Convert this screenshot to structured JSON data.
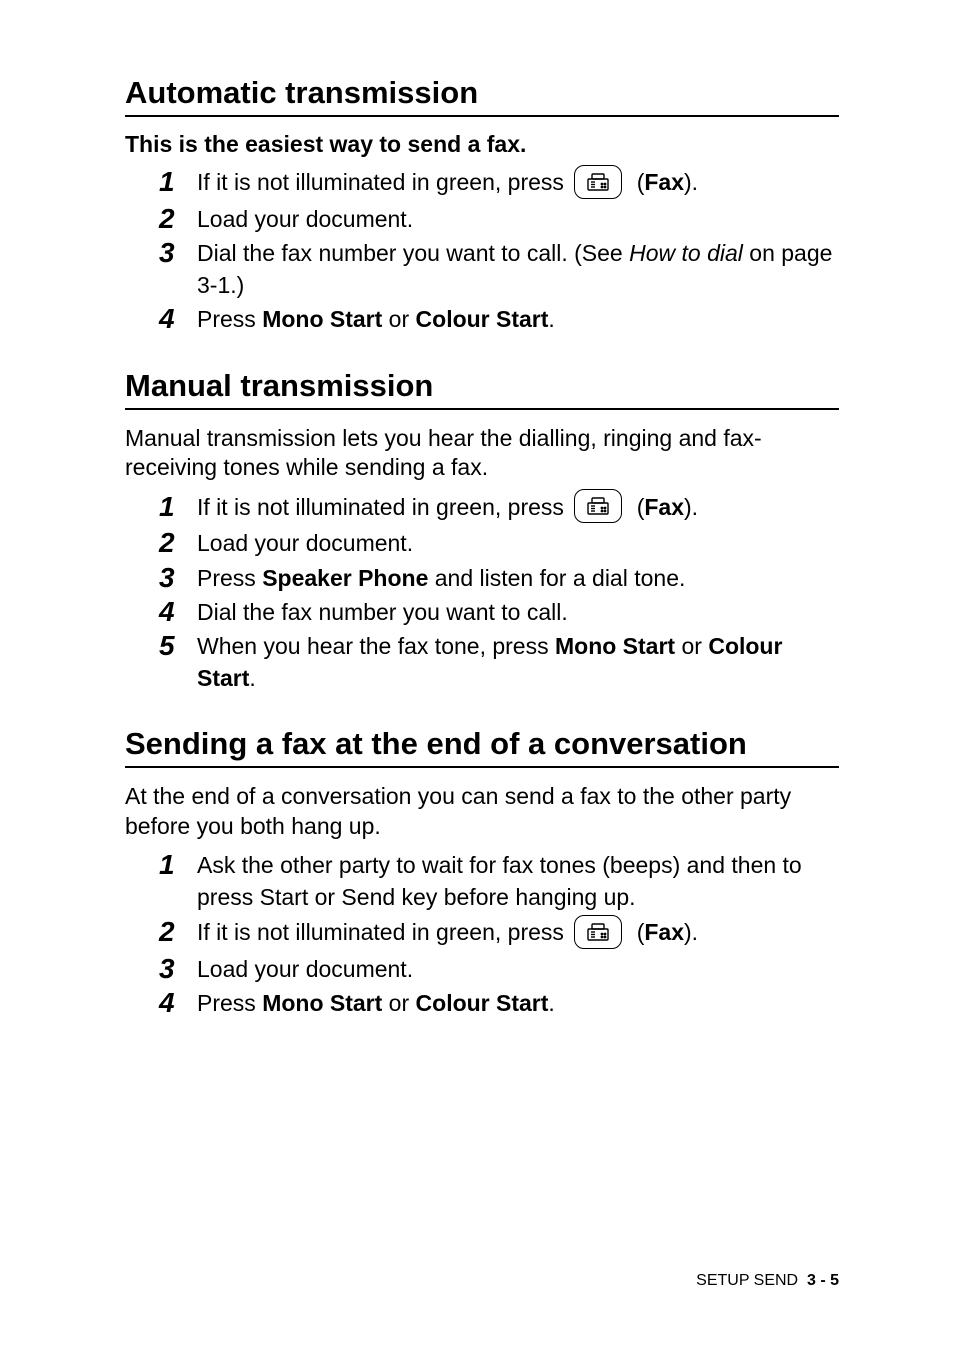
{
  "sections": {
    "auto": {
      "heading": "Automatic transmission",
      "sub": "This is the easiest way to send a fax.",
      "steps": {
        "s1a": "If it is not illuminated in green, press ",
        "s1b": " (",
        "s1c": "Fax",
        "s1d": ").",
        "s2": "Load your document.",
        "s3a": "Dial the fax number you want to call. (See ",
        "s3b": "How to dial",
        "s3c": " on page 3-1.)",
        "s4a": "Press ",
        "s4b": "Mono Start",
        "s4c": " or ",
        "s4d": "Colour Start",
        "s4e": "."
      }
    },
    "manual": {
      "heading": "Manual transmission",
      "intro": "Manual transmission lets you hear the dialling, ringing and fax-receiving tones while sending a fax.",
      "steps": {
        "s1a": "If it is not illuminated in green, press ",
        "s1b": " (",
        "s1c": "Fax",
        "s1d": ").",
        "s2": "Load your document.",
        "s3a": "Press ",
        "s3b": "Speaker Phone",
        "s3c": " and listen for a dial tone.",
        "s4": "Dial the fax number you want to call.",
        "s5a": "When you hear the fax tone, press ",
        "s5b": "Mono Start",
        "s5c": " or ",
        "s5d": "Colour Start",
        "s5e": "."
      }
    },
    "endconv": {
      "heading": "Sending a fax at the end of a conversation",
      "intro": "At the end of a conversation you can send a fax to the other party before you both hang up.",
      "steps": {
        "s1": "Ask the other party to wait for fax tones (beeps) and then to press Start or Send key before hanging up.",
        "s2a": "If it is not illuminated in green, press ",
        "s2b": " (",
        "s2c": "Fax",
        "s2d": ").",
        "s3": "Load your document.",
        "s4a": "Press ",
        "s4b": "Mono Start",
        "s4c": " or ",
        "s4d": "Colour Start",
        "s4e": "."
      }
    }
  },
  "nums": {
    "1": "1",
    "2": "2",
    "3": "3",
    "4": "4",
    "5": "5"
  },
  "footer": {
    "section": "SETUP SEND",
    "page": "3 - 5"
  },
  "icon_name": "fax-icon"
}
